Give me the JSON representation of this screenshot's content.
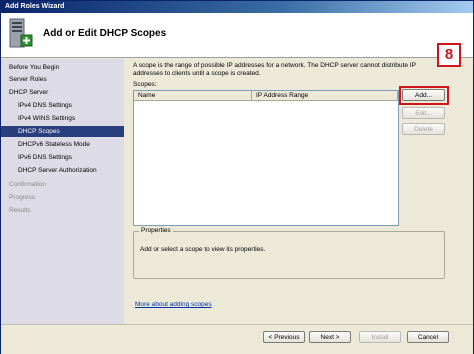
{
  "window": {
    "title": "Add Roles Wizard"
  },
  "header": {
    "title": "Add or Edit DHCP Scopes",
    "icon": "server-roles-icon"
  },
  "sidebar": {
    "items": [
      {
        "label": "Before You Begin",
        "state": "normal",
        "level": 0
      },
      {
        "label": "Server Roles",
        "state": "normal",
        "level": 0
      },
      {
        "label": "DHCP Server",
        "state": "normal",
        "level": 0
      },
      {
        "label": "IPv4 DNS Settings",
        "state": "normal",
        "level": 1
      },
      {
        "label": "IPv4 WINS Settings",
        "state": "normal",
        "level": 1
      },
      {
        "label": "DHCP Scopes",
        "state": "selected",
        "level": 1
      },
      {
        "label": "DHCPv6 Stateless Mode",
        "state": "normal",
        "level": 1
      },
      {
        "label": "IPv6 DNS Settings",
        "state": "normal",
        "level": 1
      },
      {
        "label": "DHCP Server Authorization",
        "state": "normal",
        "level": 1
      },
      {
        "label": "Confirmation",
        "state": "disabled",
        "level": 0
      },
      {
        "label": "Progress",
        "state": "disabled",
        "level": 0
      },
      {
        "label": "Results",
        "state": "disabled",
        "level": 0
      }
    ]
  },
  "main": {
    "description": "A scope is the range of possible IP addresses for a network. The DHCP server cannot distribute IP addresses to clients until a scope is created.",
    "scopes_label": "Scopes:",
    "columns": [
      "Name",
      "IP Address Range"
    ],
    "buttons": {
      "add": "Add...",
      "edit": "Edit...",
      "delete": "Delete"
    },
    "properties": {
      "legend": "Properties",
      "text": "Add or select a scope to view its properties."
    },
    "more_link": "More about adding scopes"
  },
  "annotation": {
    "step_number": "8",
    "color": "#d0151a"
  },
  "footer": {
    "previous": "< Previous",
    "next": "Next >",
    "install": "Install",
    "cancel": "Cancel"
  },
  "colors": {
    "selected_nav": "#2a3f7d",
    "title_bar": "#0a246a",
    "link": "#0033aa"
  }
}
